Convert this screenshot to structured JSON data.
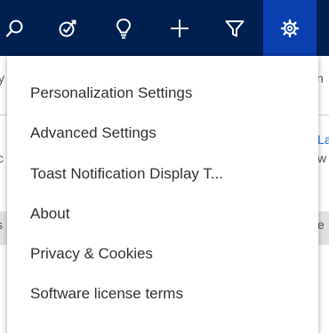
{
  "command_bar": {
    "buttons": [
      {
        "icon": "search-icon"
      },
      {
        "icon": "task-icon"
      },
      {
        "icon": "lightbulb-icon"
      },
      {
        "icon": "plus-icon"
      },
      {
        "icon": "filter-icon"
      },
      {
        "icon": "gear-icon",
        "active": true
      }
    ],
    "colors": {
      "bar_background": "#002050",
      "active_background": "#0b3fb0",
      "icon": "#ffffff"
    }
  },
  "settings_menu": {
    "items": [
      {
        "label": "Personalization Settings"
      },
      {
        "label": "Advanced Settings"
      },
      {
        "label": "Toast Notification Display T..."
      },
      {
        "label": "About"
      },
      {
        "label": "Privacy & Cookies"
      },
      {
        "label": "Software license terms"
      }
    ]
  },
  "background_fragments": {
    "left_a": "y",
    "left_b": "c",
    "left_c": "s",
    "right_a": "n",
    "right_b": "Lar",
    "right_c": "w",
    "right_d": "e"
  }
}
